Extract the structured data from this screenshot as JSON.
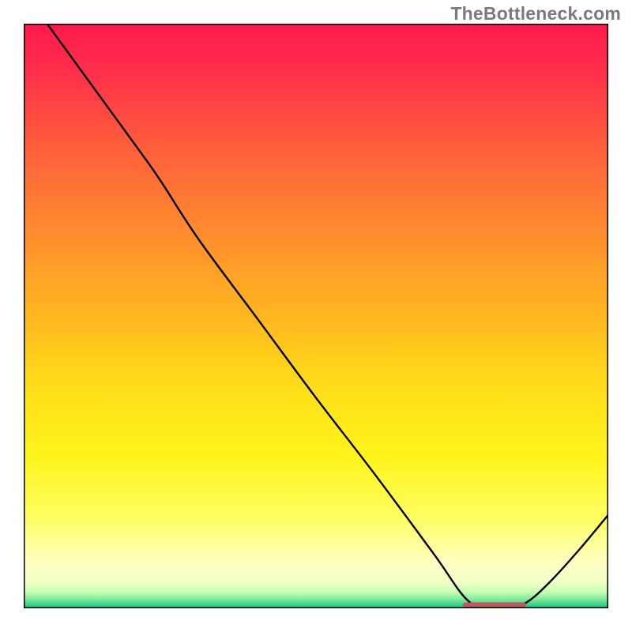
{
  "watermark": "TheBottleneck.com",
  "chart_data": {
    "type": "line",
    "title": "",
    "xlabel": "",
    "ylabel": "",
    "xlim": [
      0,
      100
    ],
    "ylim": [
      0,
      100
    ],
    "grid": false,
    "legend": false,
    "series": [
      {
        "name": "curve",
        "x": [
          4,
          12,
          20,
          23.5,
          30,
          40,
          50,
          60,
          70,
          76,
          80,
          83,
          86,
          90,
          95,
          100
        ],
        "y": [
          100,
          89,
          78,
          73,
          63,
          49.5,
          36,
          23,
          9.5,
          1.3,
          0.3,
          0.3,
          1.0,
          4.5,
          10,
          16
        ]
      }
    ],
    "marker_segment": {
      "x_start": 75.5,
      "x_end": 85.5,
      "y": 0.6,
      "color": "#c05a5a"
    },
    "gradient_stops": [
      {
        "offset": 0.0,
        "color": "#ff1a4d"
      },
      {
        "offset": 0.08,
        "color": "#ff2e4a"
      },
      {
        "offset": 0.2,
        "color": "#ff5a3d"
      },
      {
        "offset": 0.35,
        "color": "#ff8a2f"
      },
      {
        "offset": 0.5,
        "color": "#ffb71f"
      },
      {
        "offset": 0.62,
        "color": "#ffdd1a"
      },
      {
        "offset": 0.74,
        "color": "#fff41a"
      },
      {
        "offset": 0.85,
        "color": "#ffff66"
      },
      {
        "offset": 0.92,
        "color": "#ffffc0"
      },
      {
        "offset": 0.955,
        "color": "#f0ffc8"
      },
      {
        "offset": 0.972,
        "color": "#c8ffb0"
      },
      {
        "offset": 0.985,
        "color": "#7de89a"
      },
      {
        "offset": 0.995,
        "color": "#2dcf88"
      },
      {
        "offset": 1.0,
        "color": "#12c97f"
      }
    ],
    "frame_color": "#000000",
    "line_color": "#000000"
  }
}
